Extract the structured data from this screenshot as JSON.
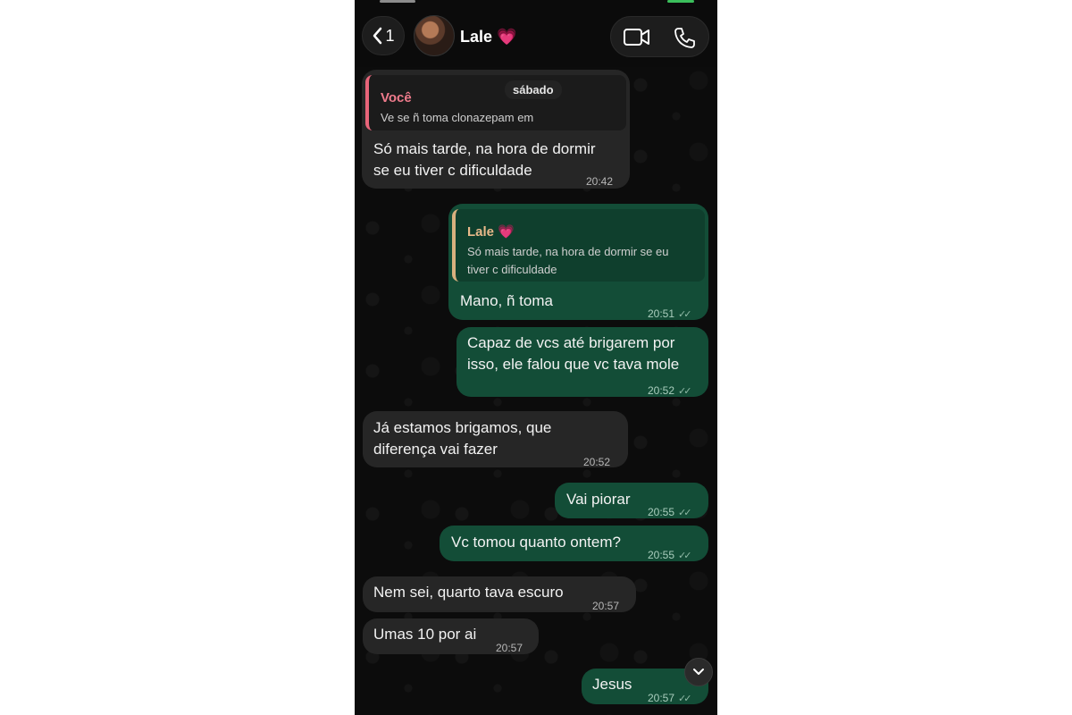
{
  "header": {
    "back_count": "1",
    "contact_name": "Lale 💗"
  },
  "date_separator": "sábado",
  "messages": [
    {
      "direction": "in",
      "quote": {
        "author": "Você",
        "text": "Ve se ñ toma clonazepam em"
      },
      "text": "Só mais tarde, na hora de dormir\nse eu tiver c dificuldade",
      "time": "20:42"
    },
    {
      "direction": "out",
      "quote": {
        "author": "Lale 💗",
        "text": "Só mais tarde, na hora de dormir se eu\ntiver c dificuldade"
      },
      "text": "Mano, ñ toma",
      "time": "20:51"
    },
    {
      "direction": "out",
      "text": "Capaz de vcs até brigarem por\nisso, ele falou que vc tava mole",
      "time": "20:52"
    },
    {
      "direction": "in",
      "text": "Já estamos brigamos, que\ndiferença vai fazer",
      "time": "20:52"
    },
    {
      "direction": "out",
      "text": "Vai piorar",
      "time": "20:55"
    },
    {
      "direction": "out",
      "text": "Vc tomou quanto ontem?",
      "time": "20:55"
    },
    {
      "direction": "in",
      "text": "Nem sei, quarto tava escuro",
      "time": "20:57"
    },
    {
      "direction": "in",
      "text": "Umas 10 por ai",
      "time": "20:57"
    },
    {
      "direction": "out",
      "text": "Jesus",
      "time": "20:57"
    }
  ],
  "colors": {
    "incoming_bubble": "#262626",
    "outgoing_bubble": "#134d37",
    "quote_you_accent": "#e8657a",
    "quote_contact_accent": "#d8b07e"
  },
  "icons": [
    "back-chevron-icon",
    "video-call-icon",
    "voice-call-icon",
    "read-receipt-icon",
    "chevron-down-icon"
  ]
}
